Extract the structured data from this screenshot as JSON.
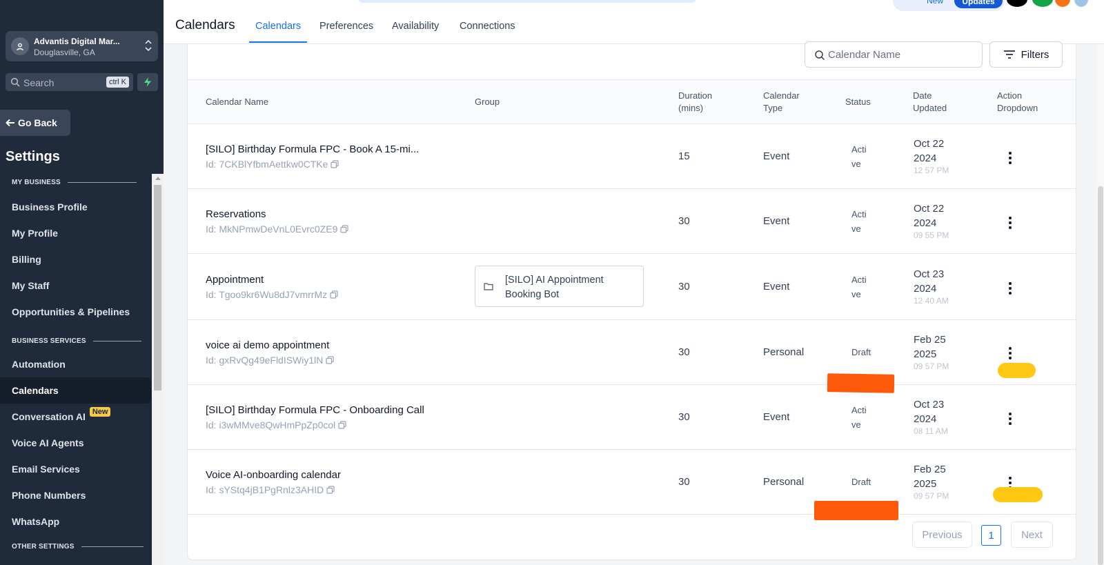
{
  "account": {
    "name": "Advantis Digital Mar...",
    "location": "Douglasville, GA"
  },
  "sidebar": {
    "search_placeholder": "Search",
    "search_shortcut": "ctrl K",
    "go_back": "Go Back",
    "title": "Settings",
    "sections": {
      "my_business": "MY BUSINESS",
      "business_services": "BUSINESS SERVICES",
      "other_settings": "OTHER SETTINGS"
    },
    "items": [
      {
        "label": "Business Profile"
      },
      {
        "label": "My Profile"
      },
      {
        "label": "Billing"
      },
      {
        "label": "My Staff"
      },
      {
        "label": "Opportunities & Pipelines"
      },
      {
        "label": "Automation"
      },
      {
        "label": "Calendars"
      },
      {
        "label": "Conversation AI",
        "badge": "New"
      },
      {
        "label": "Voice AI Agents"
      },
      {
        "label": "Email Services"
      },
      {
        "label": "Phone Numbers"
      },
      {
        "label": "WhatsApp"
      }
    ]
  },
  "header": {
    "title": "Calendars",
    "tabs": [
      {
        "label": "Calendars"
      },
      {
        "label": "Preferences"
      },
      {
        "label": "Availability"
      },
      {
        "label": "Connections"
      }
    ],
    "pill_new": "New",
    "pill_updates": "Updates"
  },
  "toolbar": {
    "search_placeholder": "Calendar Name",
    "filters_label": "Filters"
  },
  "table": {
    "headers": {
      "name": "Calendar Name",
      "group": "Group",
      "duration": [
        "Duration",
        "(mins)"
      ],
      "type": [
        "Calendar",
        "Type"
      ],
      "status": "Status",
      "updated": [
        "Date",
        "Updated"
      ],
      "action": [
        "Action",
        "Dropdown"
      ]
    },
    "rows": [
      {
        "name": "[SILO] Birthday Formula FPC - Book A 15-mi...",
        "id": "Id: 7CKBlYfbmAettkw0CTKe",
        "group": "",
        "duration": "15",
        "type": "Event",
        "status": [
          "Acti",
          "ve"
        ],
        "date": [
          "Oct 22",
          "2024"
        ],
        "time": "12 57 PM"
      },
      {
        "name": "Reservations",
        "id": "Id: MkNPmwDeVnL0Evrc0ZE9",
        "group": "",
        "duration": "30",
        "type": "Event",
        "status": [
          "Acti",
          "ve"
        ],
        "date": [
          "Oct 22",
          "2024"
        ],
        "time": "09 55 PM"
      },
      {
        "name": "Appointment",
        "id": "Id: Tgoo9kr6Wu8dJ7vmrrMz",
        "group": "[SILO] AI Appointment Booking Bot",
        "duration": "30",
        "type": "Event",
        "status": [
          "Acti",
          "ve"
        ],
        "date": [
          "Oct 23",
          "2024"
        ],
        "time": "12 40 AM"
      },
      {
        "name": "voice ai demo appointment",
        "id": "Id: gxRvQg49eFldISWiy1lN",
        "group": "",
        "duration": "30",
        "type": "Personal",
        "status": [
          "Draft",
          ""
        ],
        "date": [
          "Feb 25",
          "2025"
        ],
        "time": "09 57 PM"
      },
      {
        "name": "[SILO] Birthday Formula FPC - Onboarding Call",
        "id": "Id: i3wMMve8QwHmPpZp0col",
        "group": "",
        "duration": "30",
        "type": "Event",
        "status": [
          "Acti",
          "ve"
        ],
        "date": [
          "Oct 23",
          "2024"
        ],
        "time": "08 11 AM"
      },
      {
        "name": "Voice AI-onboarding calendar",
        "id": "Id: sYStq4jB1PgRnlz3AHID",
        "group": "",
        "duration": "30",
        "type": "Personal",
        "status": [
          "Draft",
          ""
        ],
        "date": [
          "Feb 25",
          "2025"
        ],
        "time": "09 57 PM"
      }
    ]
  },
  "pagination": {
    "previous": "Previous",
    "page": "1",
    "next": "Next"
  },
  "colors": {
    "sidebar_bg": "#1f2a3b",
    "accent": "#1570ef",
    "annotation_orange": "#ff5a0a",
    "annotation_yellow": "#ffc812"
  }
}
